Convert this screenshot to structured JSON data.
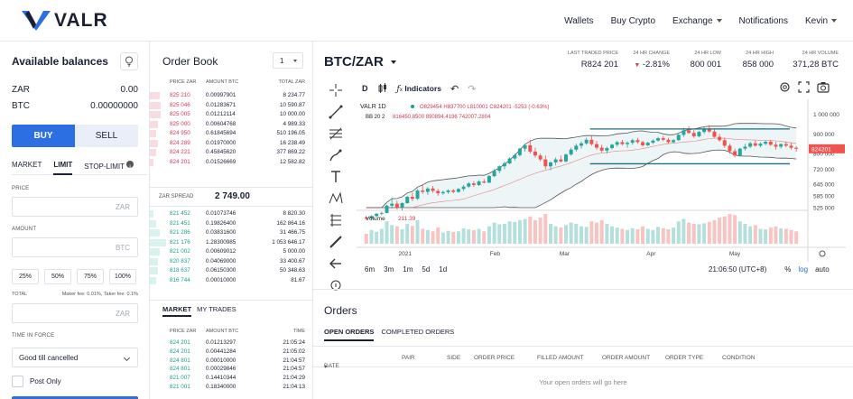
{
  "header": {
    "brand": "VALR",
    "nav": [
      "Wallets",
      "Buy Crypto",
      "Exchange",
      "Notifications",
      "Kevin"
    ]
  },
  "balances": {
    "title": "Available balances",
    "items": [
      {
        "currency": "ZAR",
        "amount": "0.00"
      },
      {
        "currency": "BTC",
        "amount": "0.00000000"
      }
    ]
  },
  "trade_form": {
    "buy_label": "BUY",
    "sell_label": "SELL",
    "order_types": [
      "MARKET",
      "LIMIT",
      "STOP-LIMIT"
    ],
    "active_order_type": "LIMIT",
    "price_label": "PRICE",
    "price_placeholder": "ZAR",
    "amount_label": "AMOUNT",
    "amount_placeholder": "BTC",
    "percentages": [
      "25%",
      "50%",
      "75%",
      "100%"
    ],
    "total_label": "TOTAL",
    "fees": "Maker fee: 0.01%, Taker fee: 0.1%",
    "total_placeholder": "ZAR",
    "tif_label": "TIME IN FORCE",
    "tif_value": "Good till cancelled",
    "post_only_label": "Post Only"
  },
  "orderbook": {
    "title": "Order Book",
    "grouping": "1",
    "headers": [
      "PRICE ZAR",
      "AMOUNT BTC",
      "TOTAL ZAR"
    ],
    "asks": [
      {
        "price": "825 210",
        "amount": "0.00997901",
        "total": "8 234.77",
        "depth": 0.06
      },
      {
        "price": "825 046",
        "amount": "0.01283671",
        "total": "10 590.87",
        "depth": 0.07
      },
      {
        "price": "825 005",
        "amount": "0.01212114",
        "total": "10 000.00",
        "depth": 0.07
      },
      {
        "price": "825 000",
        "amount": "0.00604768",
        "total": "4 989.33",
        "depth": 0.05
      },
      {
        "price": "824 950",
        "amount": "0.61845694",
        "total": "510 196.05",
        "depth": 0.04
      },
      {
        "price": "824 289",
        "amount": "0.01970000",
        "total": "16 238.49",
        "depth": 0.05
      },
      {
        "price": "824 221",
        "amount": "0.45845620",
        "total": "377 869.22",
        "depth": 0.04
      },
      {
        "price": "824 201",
        "amount": "0.01526669",
        "total": "12 582.82",
        "depth": 0.02
      }
    ],
    "spread_label": "ZAR SPREAD",
    "spread_value": "2 749.00",
    "bids": [
      {
        "price": "821 452",
        "amount": "0.01073746",
        "total": "8 820.30",
        "depth": 0.02
      },
      {
        "price": "821 451",
        "amount": "0.19826400",
        "total": "162 864.16",
        "depth": 0.04
      },
      {
        "price": "821 286",
        "amount": "0.03831600",
        "total": "31 466.75",
        "depth": 0.06
      },
      {
        "price": "821 176",
        "amount": "1.28300985",
        "total": "1 053 646.17",
        "depth": 0.1
      },
      {
        "price": "821 002",
        "amount": "0.00609012",
        "total": "5 000.00",
        "depth": 0.06
      },
      {
        "price": "820 837",
        "amount": "0.04069000",
        "total": "33 400.67",
        "depth": 0.05
      },
      {
        "price": "818 637",
        "amount": "0.06150300",
        "total": "50 348.63",
        "depth": 0.05
      },
      {
        "price": "816 744",
        "amount": "0.00010000",
        "total": "81.67",
        "depth": 0.04
      }
    ]
  },
  "trades": {
    "tabs": [
      "MARKET",
      "MY TRADES"
    ],
    "headers": [
      "PRICE ZAR",
      "AMOUNT BTC",
      "TIME"
    ],
    "rows": [
      {
        "price": "824 201",
        "amount": "0.01213297",
        "time": "21:05:24"
      },
      {
        "price": "824 201",
        "amount": "0.00441284",
        "time": "21:05:02"
      },
      {
        "price": "824 801",
        "amount": "0.00010000",
        "time": "21:04:57"
      },
      {
        "price": "824 801",
        "amount": "0.00029846",
        "time": "21:04:57"
      },
      {
        "price": "821 007",
        "amount": "0.14410344",
        "time": "21:04:29"
      },
      {
        "price": "821 001",
        "amount": "0.18340000",
        "time": "21:04:13"
      }
    ]
  },
  "market": {
    "pair": "BTC/ZAR",
    "stats": [
      {
        "label": "LAST TRADED PRICE",
        "value": "R824 201"
      },
      {
        "label": "24 HR CHANGE",
        "value": "-2.81%"
      },
      {
        "label": "24 HR LOW",
        "value": "800 001"
      },
      {
        "label": "24 HR HIGH",
        "value": "858 000"
      },
      {
        "label": "24 HR VOLUME",
        "value": "371,28 BTC"
      }
    ]
  },
  "chart": {
    "interval": "D",
    "indicators_label": "Indicators",
    "legend_symbol": "VALR",
    "legend_interval": "1D",
    "legend_values": "O829454 H837700 L810001 C824201 -5253 (-0.63%)",
    "bb_label": "BB 20 2",
    "bb_values": "816450.8500 890894.4196 742007.2804",
    "volume_label": "Volume",
    "volume_value": "211.39",
    "last_price_tag": "824201",
    "timeframes": [
      "6m",
      "3m",
      "1m",
      "5d",
      "1d"
    ],
    "clock": "21:06:50 (UTC+8)",
    "pct_label": "%",
    "log_label": "log",
    "auto_label": "auto",
    "colors": {
      "up": "#26a69a",
      "down": "#ef5350",
      "line": "#1e6f7a",
      "band": "#555555"
    }
  },
  "chart_data": {
    "type": "candlestick",
    "x_ticks": [
      "2021",
      "Feb",
      "Mar",
      "Apr",
      "May"
    ],
    "y_ticks": [
      1000000,
      900000,
      800000,
      720000,
      645000,
      585000,
      525000
    ],
    "ylim": [
      525000,
      1030000
    ],
    "ohlc": [
      [
        475000,
        480000,
        462000,
        470000
      ],
      [
        470000,
        486000,
        466000,
        482000
      ],
      [
        482000,
        498000,
        478000,
        494000
      ],
      [
        494000,
        505000,
        486000,
        498000
      ],
      [
        498000,
        540000,
        495000,
        535000
      ],
      [
        535000,
        575000,
        520000,
        545000
      ],
      [
        545000,
        560000,
        515000,
        525000
      ],
      [
        525000,
        552000,
        510000,
        548000
      ],
      [
        548000,
        585000,
        545000,
        580000
      ],
      [
        580000,
        600000,
        558000,
        570000
      ],
      [
        570000,
        620000,
        565000,
        612000
      ],
      [
        612000,
        640000,
        595000,
        605000
      ],
      [
        605000,
        630000,
        590000,
        622000
      ],
      [
        622000,
        635000,
        600000,
        610000
      ],
      [
        610000,
        620000,
        585000,
        598000
      ],
      [
        598000,
        612000,
        590000,
        604000
      ],
      [
        604000,
        618000,
        595000,
        612000
      ],
      [
        612000,
        620000,
        598000,
        605000
      ],
      [
        605000,
        625000,
        600000,
        620000
      ],
      [
        620000,
        640000,
        610000,
        632000
      ],
      [
        632000,
        655000,
        625000,
        648000
      ],
      [
        648000,
        660000,
        630000,
        640000
      ],
      [
        640000,
        665000,
        635000,
        658000
      ],
      [
        658000,
        670000,
        648000,
        652000
      ],
      [
        652000,
        690000,
        650000,
        685000
      ],
      [
        685000,
        720000,
        680000,
        712000
      ],
      [
        712000,
        740000,
        700000,
        735000
      ],
      [
        735000,
        760000,
        720000,
        750000
      ],
      [
        750000,
        780000,
        745000,
        775000
      ],
      [
        775000,
        800000,
        765000,
        792000
      ],
      [
        792000,
        830000,
        785000,
        825000
      ],
      [
        825000,
        850000,
        810000,
        842000
      ],
      [
        842000,
        870000,
        800000,
        810000
      ],
      [
        810000,
        830000,
        780000,
        790000
      ],
      [
        790000,
        800000,
        760000,
        770000
      ],
      [
        770000,
        790000,
        720000,
        735000
      ],
      [
        735000,
        760000,
        715000,
        755000
      ],
      [
        755000,
        780000,
        740000,
        770000
      ],
      [
        770000,
        790000,
        755000,
        760000
      ],
      [
        760000,
        800000,
        755000,
        795000
      ],
      [
        795000,
        830000,
        790000,
        820000
      ],
      [
        820000,
        850000,
        810000,
        840000
      ],
      [
        840000,
        860000,
        825000,
        852000
      ],
      [
        852000,
        880000,
        845000,
        870000
      ],
      [
        870000,
        890000,
        840000,
        848000
      ],
      [
        848000,
        865000,
        820000,
        830000
      ],
      [
        830000,
        845000,
        805000,
        815000
      ],
      [
        815000,
        835000,
        800000,
        828000
      ],
      [
        828000,
        850000,
        820000,
        845000
      ],
      [
        845000,
        865000,
        835000,
        858000
      ],
      [
        858000,
        870000,
        840000,
        848000
      ],
      [
        848000,
        862000,
        830000,
        855000
      ],
      [
        855000,
        875000,
        845000,
        868000
      ],
      [
        868000,
        880000,
        850000,
        858000
      ],
      [
        858000,
        866000,
        835000,
        842000
      ],
      [
        842000,
        860000,
        838000,
        855000
      ],
      [
        855000,
        872000,
        848000,
        866000
      ],
      [
        866000,
        884000,
        860000,
        878000
      ],
      [
        878000,
        890000,
        862000,
        870000
      ],
      [
        870000,
        880000,
        850000,
        858000
      ],
      [
        858000,
        874000,
        852000,
        868000
      ],
      [
        868000,
        900000,
        865000,
        895000
      ],
      [
        895000,
        930000,
        885000,
        918000
      ],
      [
        918000,
        940000,
        900000,
        905000
      ],
      [
        905000,
        920000,
        880000,
        888000
      ],
      [
        888000,
        915000,
        882000,
        910000
      ],
      [
        910000,
        935000,
        900000,
        925000
      ],
      [
        925000,
        945000,
        905000,
        912000
      ],
      [
        912000,
        925000,
        880000,
        885000
      ],
      [
        885000,
        900000,
        860000,
        868000
      ],
      [
        868000,
        880000,
        830000,
        840000
      ],
      [
        840000,
        850000,
        800000,
        812000
      ],
      [
        812000,
        825000,
        780000,
        790000
      ],
      [
        790000,
        830000,
        785000,
        825000
      ],
      [
        825000,
        850000,
        815000,
        835000
      ],
      [
        835000,
        860000,
        828000,
        852000
      ],
      [
        852000,
        866000,
        835000,
        840000
      ],
      [
        840000,
        858000,
        832000,
        850000
      ],
      [
        850000,
        866000,
        842000,
        860000
      ],
      [
        860000,
        870000,
        838000,
        845000
      ],
      [
        845000,
        860000,
        820000,
        835000
      ],
      [
        835000,
        852000,
        825000,
        848000
      ],
      [
        848000,
        862000,
        832000,
        840000
      ],
      [
        840000,
        856000,
        820000,
        829454
      ],
      [
        829454,
        837700,
        810001,
        824201
      ]
    ],
    "volume": [
      40,
      55,
      48,
      60,
      90,
      75,
      70,
      58,
      80,
      72,
      95,
      60,
      55,
      50,
      65,
      45,
      52,
      48,
      50,
      62,
      58,
      55,
      60,
      50,
      70,
      85,
      78,
      80,
      90,
      88,
      95,
      100,
      110,
      95,
      105,
      120,
      80,
      70,
      65,
      75,
      85,
      80,
      70,
      68,
      90,
      85,
      95,
      80,
      70,
      65,
      60,
      55,
      62,
      58,
      70,
      60,
      55,
      68,
      62,
      58,
      65,
      90,
      100,
      85,
      80,
      78,
      82,
      88,
      95,
      105,
      110,
      120,
      115,
      90,
      80,
      70,
      75,
      60,
      58,
      65,
      70,
      62,
      60,
      55,
      50
    ],
    "bollinger": {
      "upper": "890894.4196",
      "mid": "816450.8500",
      "lower": "742007.2804"
    },
    "channel_lines": [
      925000,
      748000
    ]
  },
  "orders": {
    "title": "Orders",
    "tabs": [
      "OPEN ORDERS",
      "COMPLETED ORDERS"
    ],
    "headers": [
      "DATE",
      "PAIR",
      "SIDE",
      "ORDER PRICE",
      "FILLED AMOUNT",
      "ORDER AMOUNT",
      "ORDER TYPE",
      "CONDITION"
    ],
    "empty_text": "Your open orders will go here"
  }
}
